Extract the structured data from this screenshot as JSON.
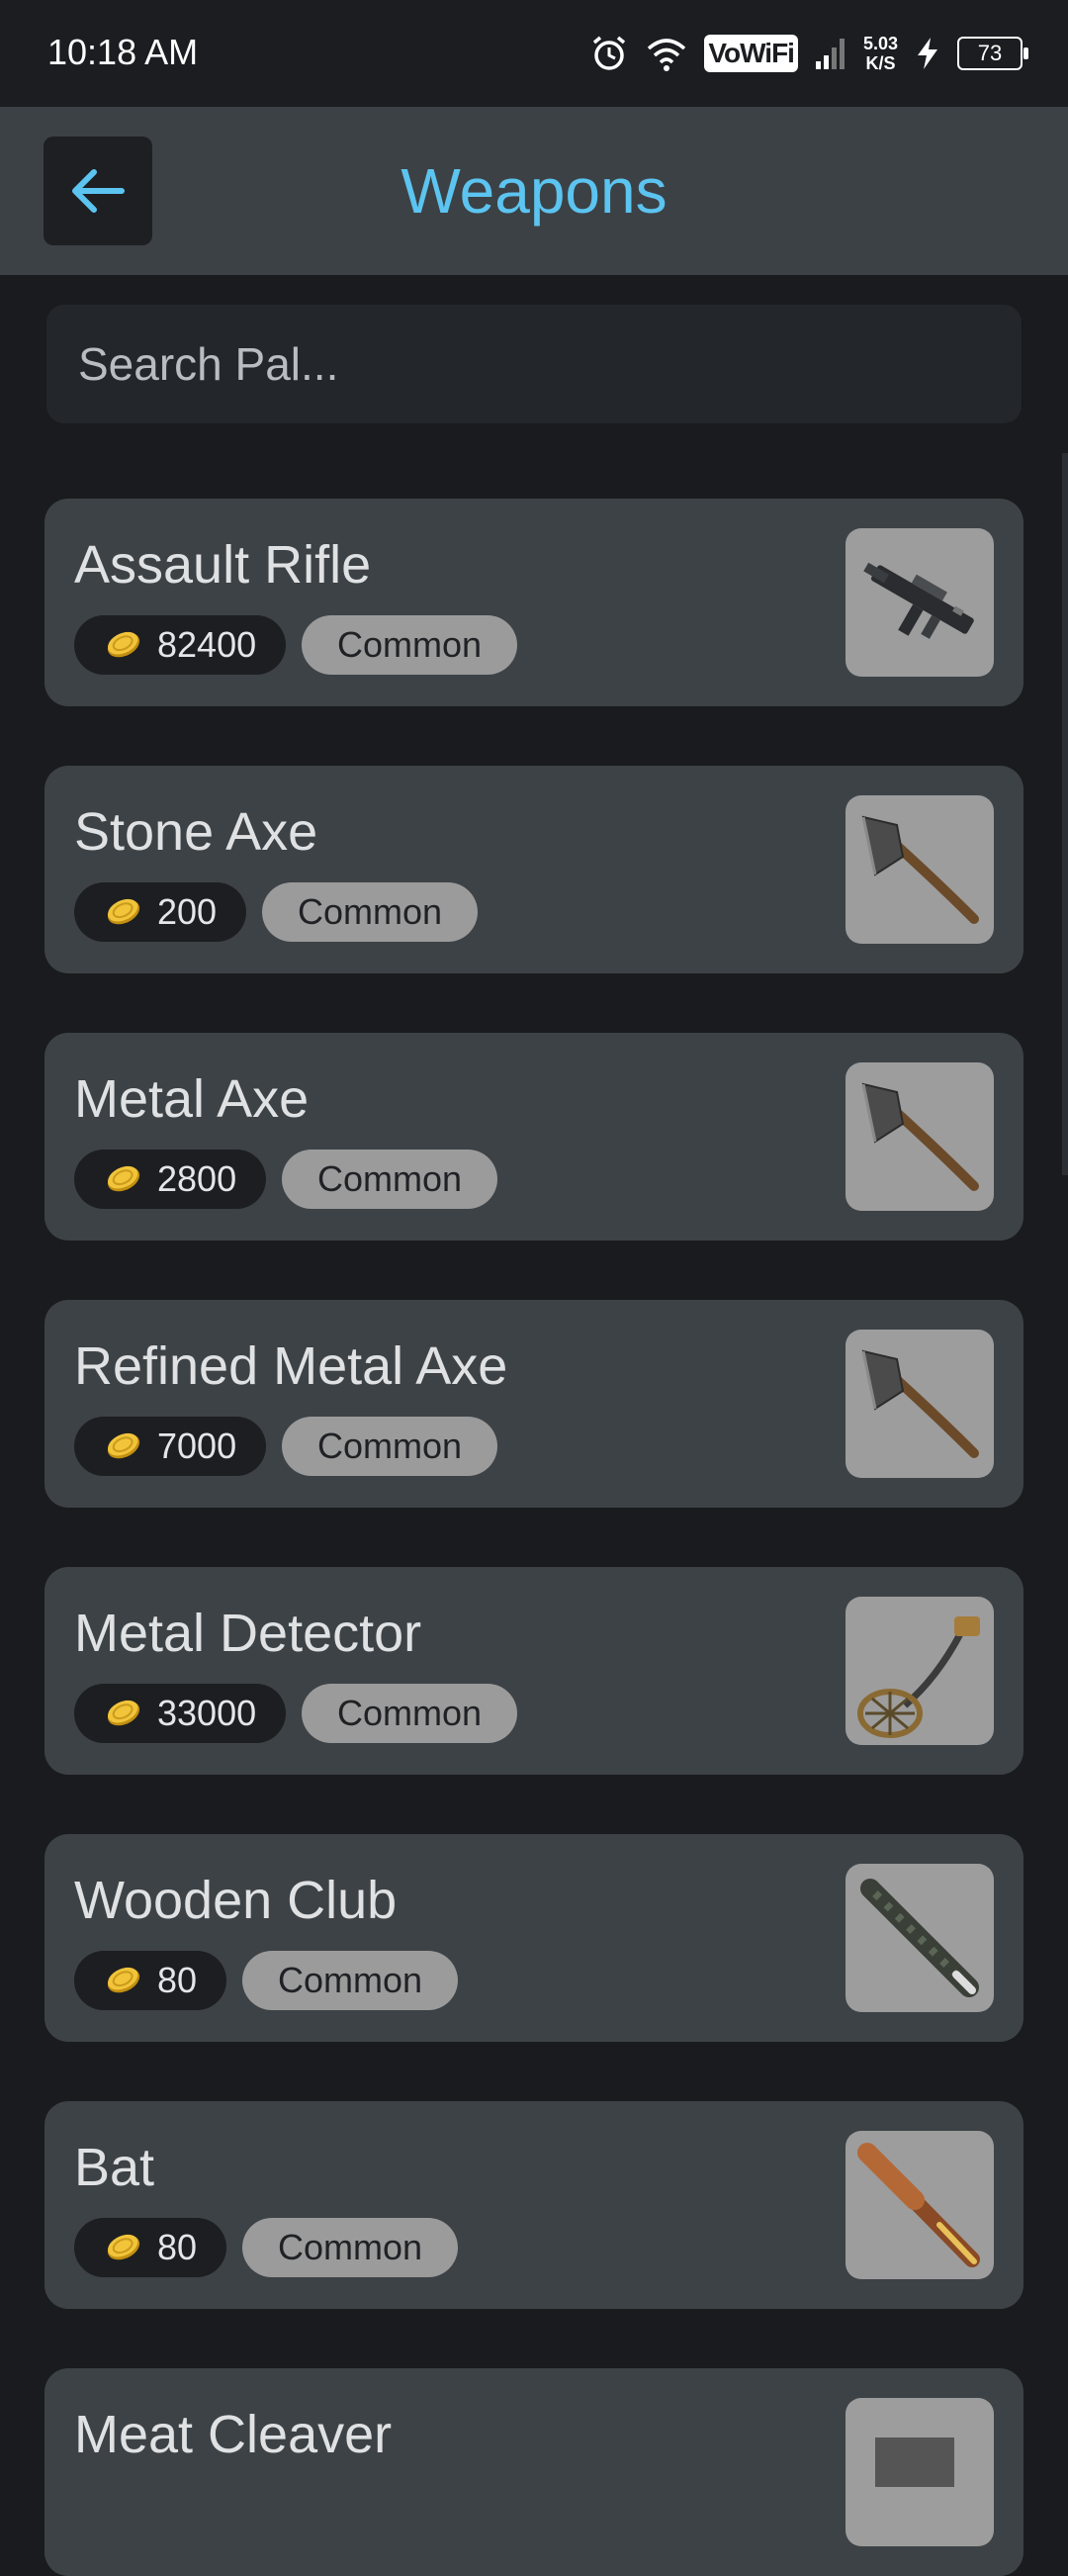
{
  "status_bar": {
    "time": "10:18 AM",
    "vowifi": "VoWiFi",
    "net_speed_value": "5.03",
    "net_speed_unit": "K/S",
    "battery": "73"
  },
  "app_bar": {
    "title": "Weapons"
  },
  "search": {
    "placeholder": "Search Pal..."
  },
  "items": [
    {
      "name": "Assault Rifle",
      "price": "82400",
      "rarity": "Common",
      "icon": "assault-rifle"
    },
    {
      "name": "Stone Axe",
      "price": "200",
      "rarity": "Common",
      "icon": "axe"
    },
    {
      "name": "Metal Axe",
      "price": "2800",
      "rarity": "Common",
      "icon": "axe"
    },
    {
      "name": "Refined Metal Axe",
      "price": "7000",
      "rarity": "Common",
      "icon": "axe"
    },
    {
      "name": "Metal Detector",
      "price": "33000",
      "rarity": "Common",
      "icon": "metal-detector"
    },
    {
      "name": "Wooden Club",
      "price": "80",
      "rarity": "Common",
      "icon": "club"
    },
    {
      "name": "Bat",
      "price": "80",
      "rarity": "Common",
      "icon": "bat"
    },
    {
      "name": "Meat Cleaver",
      "price": "",
      "rarity": "",
      "icon": "cleaver"
    }
  ],
  "colors": {
    "accent": "#5cc4f0",
    "background": "#191b1e",
    "card": "#3d4246",
    "coin": "#e8b923"
  }
}
